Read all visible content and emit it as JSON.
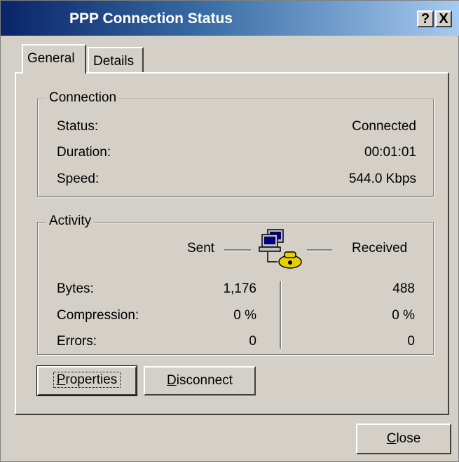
{
  "window": {
    "title": "PPP Connection Status",
    "help_label": "?",
    "close_label": "X"
  },
  "tabs": [
    {
      "label": "General",
      "active": true
    },
    {
      "label": "Details",
      "active": false
    }
  ],
  "connection": {
    "legend": "Connection",
    "status_label": "Status:",
    "status_value": "Connected",
    "duration_label": "Duration:",
    "duration_value": "00:01:01",
    "speed_label": "Speed:",
    "speed_value": "544.0 Kbps"
  },
  "activity": {
    "legend": "Activity",
    "sent_header": "Sent",
    "received_header": "Received",
    "icon": "network-computers-icon",
    "rows": [
      {
        "label": "Bytes:",
        "sent": "1,176",
        "received": "488"
      },
      {
        "label": "Compression:",
        "sent": "0 %",
        "received": "0 %"
      },
      {
        "label": "Errors:",
        "sent": "0",
        "received": "0"
      }
    ]
  },
  "buttons": {
    "properties_first": "P",
    "properties_rest": "roperties",
    "disconnect_first": "D",
    "disconnect_rest": "isconnect",
    "close_first": "C",
    "close_rest": "lose"
  }
}
